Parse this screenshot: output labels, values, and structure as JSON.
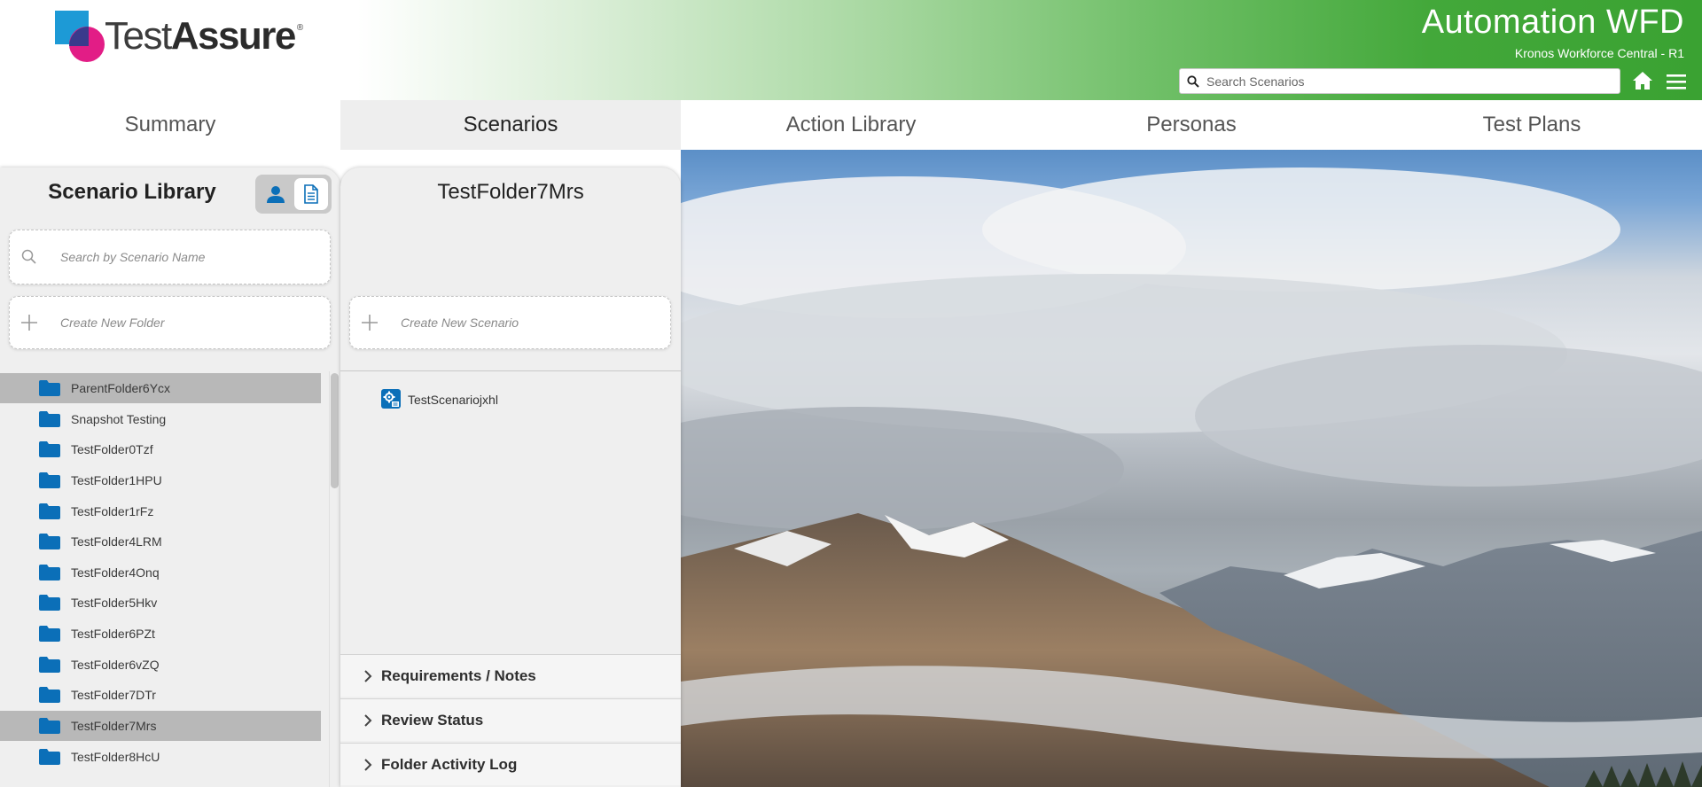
{
  "header": {
    "logo_text_light": "Test",
    "logo_text_bold": "Assure",
    "logo_reg": "®",
    "app_title": "Automation WFD",
    "app_subtitle": "Kronos Workforce Central - R1",
    "search_placeholder": "Search Scenarios"
  },
  "tabs": [
    {
      "label": "Summary",
      "active": false
    },
    {
      "label": "Scenarios",
      "active": true
    },
    {
      "label": "Action Library",
      "active": false
    },
    {
      "label": "Personas",
      "active": false
    },
    {
      "label": "Test Plans",
      "active": false
    }
  ],
  "library": {
    "title": "Scenario Library",
    "search_placeholder": "Search by Scenario Name",
    "create_folder_label": "Create New Folder",
    "folders": [
      {
        "name": "ParentFolder6Ycx",
        "selected": true
      },
      {
        "name": "Snapshot Testing",
        "selected": false
      },
      {
        "name": "TestFolder0Tzf",
        "selected": false
      },
      {
        "name": "TestFolder1HPU",
        "selected": false
      },
      {
        "name": "TestFolder1rFz",
        "selected": false
      },
      {
        "name": "TestFolder4LRM",
        "selected": false
      },
      {
        "name": "TestFolder4Onq",
        "selected": false
      },
      {
        "name": "TestFolder5Hkv",
        "selected": false
      },
      {
        "name": "TestFolder6PZt",
        "selected": false
      },
      {
        "name": "TestFolder6vZQ",
        "selected": false
      },
      {
        "name": "TestFolder7DTr",
        "selected": false
      },
      {
        "name": "TestFolder7Mrs",
        "selected": true
      },
      {
        "name": "TestFolder8HcU",
        "selected": false
      }
    ]
  },
  "folder_view": {
    "title": "TestFolder7Mrs",
    "create_scenario_label": "Create New Scenario",
    "scenarios": [
      "TestScenariojxhl"
    ],
    "sections": [
      "Requirements / Notes",
      "Review Status",
      "Folder Activity Log"
    ]
  },
  "colors": {
    "brand_green": "#3aa232",
    "folder_blue": "#0b6fb8",
    "selected_row": "#b8b8b8"
  }
}
